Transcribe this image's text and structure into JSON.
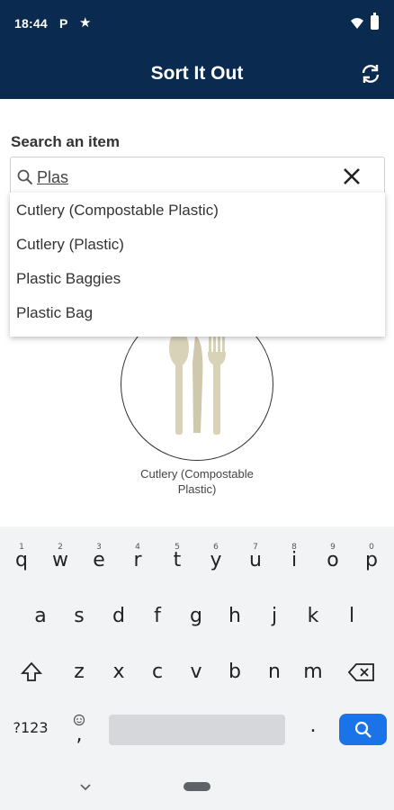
{
  "status_bar": {
    "time": "18:44",
    "notification_letter": "P",
    "star_glyph": "★",
    "wifi_icon": "wifi-icon",
    "battery_icon": "battery-icon"
  },
  "app_bar": {
    "title": "Sort It Out",
    "action_icon": "refresh-icon",
    "background_color": "#0b2a50"
  },
  "search": {
    "label": "Search an item",
    "value": "Plas",
    "leading_icon": "search-icon",
    "clear_icon": "close-icon"
  },
  "suggestions": [
    "Cutlery (Compostable Plastic)",
    "Cutlery (Plastic)",
    "Plastic Baggies",
    "Plastic Bag"
  ],
  "result": {
    "caption": "Cutlery (Compostable Plastic)",
    "image_icon": "compostable-cutlery-icon"
  },
  "keyboard": {
    "row1": [
      {
        "key": "q",
        "hint": "1"
      },
      {
        "key": "w",
        "hint": "2"
      },
      {
        "key": "e",
        "hint": "3"
      },
      {
        "key": "r",
        "hint": "4"
      },
      {
        "key": "t",
        "hint": "5"
      },
      {
        "key": "y",
        "hint": "6"
      },
      {
        "key": "u",
        "hint": "7"
      },
      {
        "key": "i",
        "hint": "8"
      },
      {
        "key": "o",
        "hint": "9"
      },
      {
        "key": "p",
        "hint": "0"
      }
    ],
    "row2": [
      "a",
      "s",
      "d",
      "f",
      "g",
      "h",
      "j",
      "k",
      "l"
    ],
    "row3": [
      "z",
      "x",
      "c",
      "v",
      "b",
      "n",
      "m"
    ],
    "symbols_key": "?123",
    "comma_key": ",",
    "period_key": ".",
    "shift_icon": "shift-icon",
    "backspace_icon": "backspace-icon",
    "emoji_icon": "emoji-icon",
    "search_key_icon": "search-icon",
    "search_key_color": "#1a73e8"
  },
  "nav_bar": {
    "back_icon": "chevron-down-icon",
    "home_icon": "home-pill-icon"
  }
}
